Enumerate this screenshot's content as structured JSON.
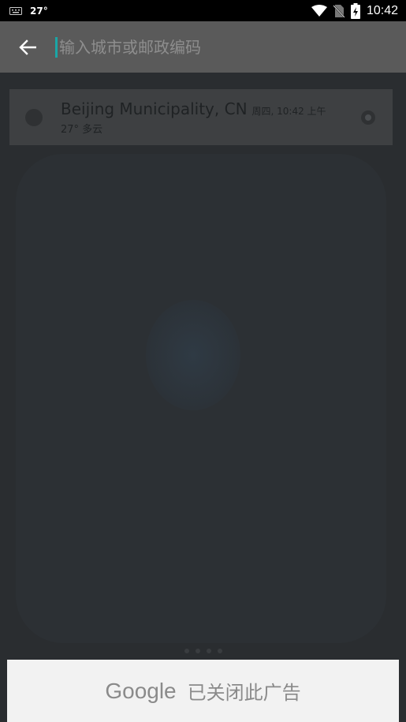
{
  "status_bar": {
    "temperature": "27°",
    "time": "10:42"
  },
  "search": {
    "placeholder": "输入城市或邮政编码"
  },
  "result": {
    "city": "Beijing Municipality, CN",
    "meta": "周四, 10:42 上午",
    "subtitle": "27° 多云"
  },
  "ad": {
    "brand": "Google",
    "message": "已关闭此广告"
  },
  "colors": {
    "accent": "#1aa6a6",
    "app_bar": "#5a5a5a",
    "background": "#2a2d30"
  }
}
